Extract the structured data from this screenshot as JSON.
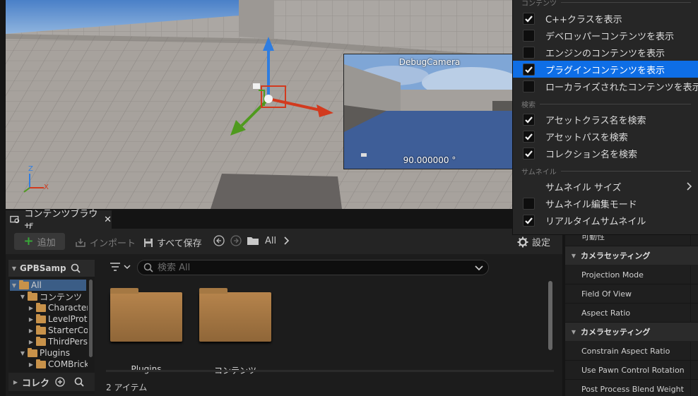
{
  "viewport": {
    "debug_camera_title": "DebugCamera",
    "debug_camera_angle": "90.000000 °",
    "axis_z": "Z",
    "axis_x": "X"
  },
  "content_browser": {
    "tab_label": "コンテンツブラウザ",
    "toolbar": {
      "add_label": "追加",
      "import_label": "インポート",
      "save_all_label": "すべて保存",
      "path": [
        "All"
      ],
      "settings_label": "設定"
    },
    "sources": {
      "project_name": "GPBSample",
      "tree": [
        {
          "label": "All",
          "level": 0,
          "expanded": true,
          "selected": true
        },
        {
          "label": "コンテンツ",
          "level": 1,
          "expanded": true,
          "selected": false
        },
        {
          "label": "Characters",
          "level": 2,
          "expanded": false,
          "selected": false
        },
        {
          "label": "LevelPrototyping",
          "level": 2,
          "expanded": false,
          "selected": false
        },
        {
          "label": "StarterContent",
          "level": 2,
          "expanded": false,
          "selected": false
        },
        {
          "label": "ThirdPerson",
          "level": 2,
          "expanded": false,
          "selected": false
        },
        {
          "label": "Plugins",
          "level": 1,
          "expanded": true,
          "selected": false
        },
        {
          "label": "COMBrick",
          "level": 2,
          "expanded": false,
          "selected": false
        }
      ],
      "collections_label": "コレク"
    },
    "search": {
      "placeholder": "検索 All",
      "value": ""
    },
    "assets": [
      {
        "label": "Plugins",
        "type": "folder"
      },
      {
        "label": "コンテンツ",
        "type": "folder"
      }
    ],
    "item_count": "2 アイテム"
  },
  "details": {
    "rows": [
      {
        "kind": "row",
        "label": "可動性"
      },
      {
        "kind": "category",
        "label": "カメラセッティング"
      },
      {
        "kind": "row",
        "label": "Projection Mode"
      },
      {
        "kind": "row",
        "label": "Field Of View"
      },
      {
        "kind": "row",
        "label": "Aspect Ratio"
      },
      {
        "kind": "category",
        "label": "カメラセッティング"
      },
      {
        "kind": "row",
        "label": "Constrain Aspect Ratio"
      },
      {
        "kind": "row",
        "label": "Use Pawn Control Rotation"
      },
      {
        "kind": "row",
        "label": "Post Process Blend Weight"
      }
    ]
  },
  "menu": {
    "sections": [
      {
        "title": "コンテンツ",
        "items": [
          {
            "label": "C++クラスを表示",
            "checked": true,
            "highlighted": false
          },
          {
            "label": "デベロッパーコンテンツを表示",
            "checked": false,
            "highlighted": false
          },
          {
            "label": "エンジンのコンテンツを表示",
            "checked": false,
            "highlighted": false
          },
          {
            "label": "プラグインコンテンツを表示",
            "checked": true,
            "highlighted": true
          },
          {
            "label": "ローカライズされたコンテンツを表示",
            "checked": false,
            "highlighted": false
          }
        ]
      },
      {
        "title": "検索",
        "items": [
          {
            "label": "アセットクラス名を検索",
            "checked": true,
            "highlighted": false
          },
          {
            "label": "アセットパスを検索",
            "checked": true,
            "highlighted": false
          },
          {
            "label": "コレクション名を検索",
            "checked": true,
            "highlighted": false
          }
        ]
      },
      {
        "title": "サムネイル",
        "items": [
          {
            "label": "サムネイル サイズ",
            "checked": null,
            "highlighted": false,
            "submenu": true
          },
          {
            "label": "サムネイル編集モード",
            "checked": false,
            "highlighted": false
          },
          {
            "label": "リアルタイムサムネイル",
            "checked": true,
            "highlighted": false
          }
        ]
      }
    ]
  },
  "colors": {
    "highlight": "#0e6ee6",
    "gizmo_z": "#2f7de0",
    "gizmo_x": "#d23a1e",
    "gizmo_y": "#4f9a1e",
    "folder": "#b6844c",
    "add_plus": "#38a838"
  }
}
